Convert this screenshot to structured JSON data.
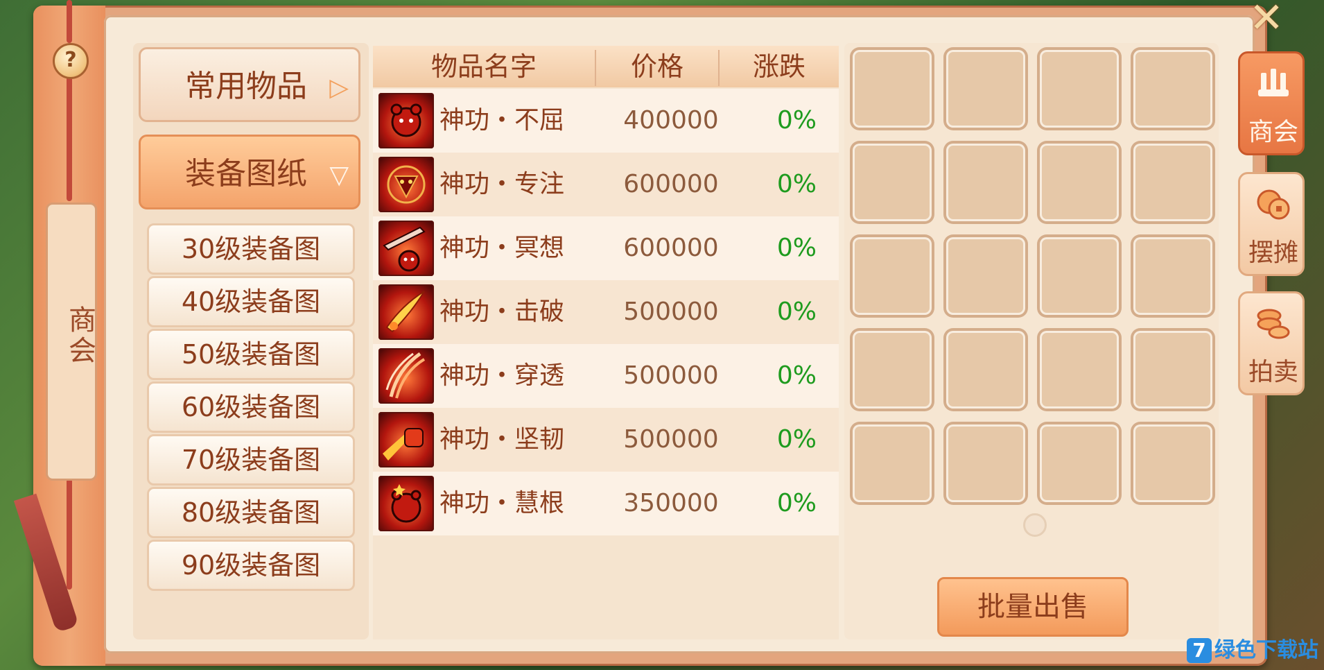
{
  "ui": {
    "help_icon": "?",
    "spine_label": "商会",
    "close_icon": "✕"
  },
  "categories": {
    "common": {
      "label": "常用物品",
      "arrow": "▷"
    },
    "equip": {
      "label": "装备图纸",
      "arrow": "▽"
    },
    "sub_items": [
      {
        "label": "30级装备图"
      },
      {
        "label": "40级装备图"
      },
      {
        "label": "50级装备图"
      },
      {
        "label": "60级装备图"
      },
      {
        "label": "70级装备图"
      },
      {
        "label": "80级装备图"
      },
      {
        "label": "90级装备图"
      }
    ]
  },
  "table": {
    "headers": [
      "物品名字",
      "价格",
      "涨跌"
    ],
    "rows": [
      {
        "name": "神功・不屈",
        "price": "400000",
        "change": "0%",
        "icon": "bear-head-icon"
      },
      {
        "name": "神功・专注",
        "price": "600000",
        "change": "0%",
        "icon": "demon-mask-icon"
      },
      {
        "name": "神功・冥想",
        "price": "600000",
        "change": "0%",
        "icon": "sword-bear-icon"
      },
      {
        "name": "神功・击破",
        "price": "500000",
        "change": "0%",
        "icon": "slash-icon"
      },
      {
        "name": "神功・穿透",
        "price": "500000",
        "change": "0%",
        "icon": "claw-strike-icon"
      },
      {
        "name": "神功・坚韧",
        "price": "500000",
        "change": "0%",
        "icon": "fist-icon"
      },
      {
        "name": "神功・慧根",
        "price": "350000",
        "change": "0%",
        "icon": "dizzy-bear-icon"
      }
    ]
  },
  "inventory": {
    "rows": 5,
    "cols": 4,
    "bulk_sell_label": "批量出售"
  },
  "right_tabs": [
    {
      "label": "商会",
      "icon": "chamber-icon",
      "active": true
    },
    {
      "label": "摆摊",
      "icon": "coins-icon",
      "active": false
    },
    {
      "label": "拍卖",
      "icon": "coin-stack-icon",
      "active": false
    }
  ],
  "watermark": {
    "logo": "7",
    "text": "绿色下载站"
  },
  "colors": {
    "accent": "#f39a5b",
    "text_brown": "#8c3d1c",
    "positive": "#1e9b1e",
    "panel_bg": "#f7ead8"
  }
}
